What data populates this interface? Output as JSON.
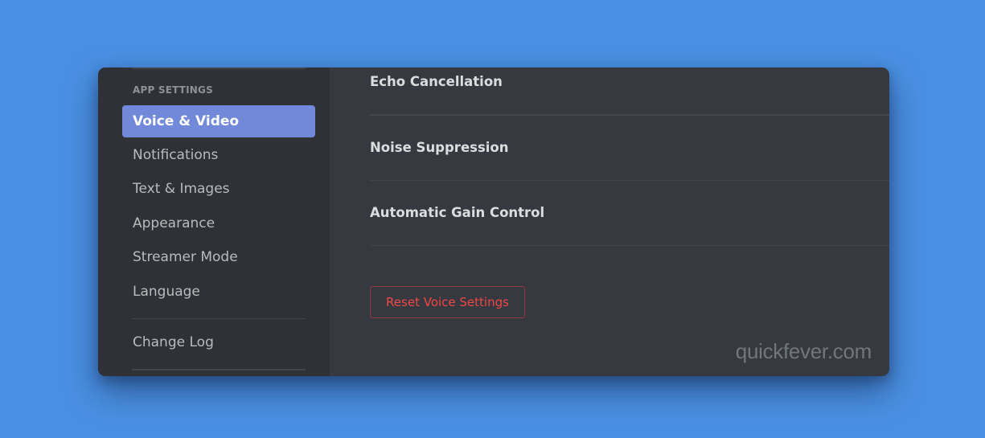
{
  "sidebar": {
    "section_header": "APP SETTINGS",
    "items": [
      {
        "label": "Voice & Video",
        "active": true
      },
      {
        "label": "Notifications",
        "active": false
      },
      {
        "label": "Text & Images",
        "active": false
      },
      {
        "label": "Appearance",
        "active": false
      },
      {
        "label": "Streamer Mode",
        "active": false
      },
      {
        "label": "Language",
        "active": false
      }
    ],
    "extra_items": [
      {
        "label": "Change Log"
      }
    ]
  },
  "content": {
    "settings": [
      {
        "label": "Echo Cancellation"
      },
      {
        "label": "Noise Suppression"
      },
      {
        "label": "Automatic Gain Control"
      }
    ],
    "reset_button_label": "Reset Voice Settings"
  },
  "watermark": "quickfever.com",
  "colors": {
    "background": "#4a90e2",
    "sidebar": "#2f3136",
    "content": "#36393f",
    "active_item": "#7289da",
    "danger": "#f04747"
  }
}
